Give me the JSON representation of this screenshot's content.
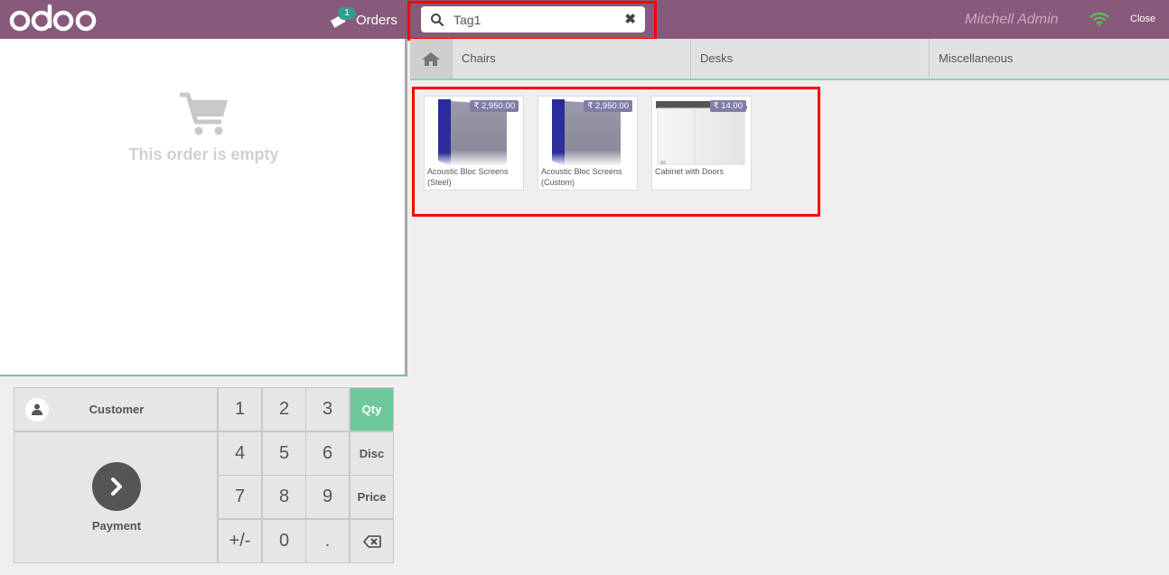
{
  "header": {
    "logo_text": "odoo",
    "orders_label": "Orders",
    "orders_count": "1",
    "search_value": "Tag1",
    "user_name": "Mitchell Admin",
    "close_label": "Close"
  },
  "order": {
    "empty_text": "This order is empty"
  },
  "controls": {
    "customer_label": "Customer",
    "payment_label": "Payment",
    "keys": [
      "1",
      "2",
      "3",
      "Qty",
      "4",
      "5",
      "6",
      "Disc",
      "7",
      "8",
      "9",
      "Price",
      "+/-",
      "0",
      ".",
      ""
    ],
    "active_mode": "Qty"
  },
  "categories": [
    "Chairs",
    "Desks",
    "Miscellaneous"
  ],
  "products": [
    {
      "name": "Acoustic Bloc Screens (Steel)",
      "price": "₹ 2,950.00"
    },
    {
      "name": "Acoustic Bloc Screens (Custom)",
      "price": "₹ 2,950.00"
    },
    {
      "name": "Cabinet with Doors",
      "price": "₹ 14.00"
    }
  ],
  "colors": {
    "header": "#875a7b",
    "accent": "#6ec89b",
    "highlight": "#ff0000"
  }
}
